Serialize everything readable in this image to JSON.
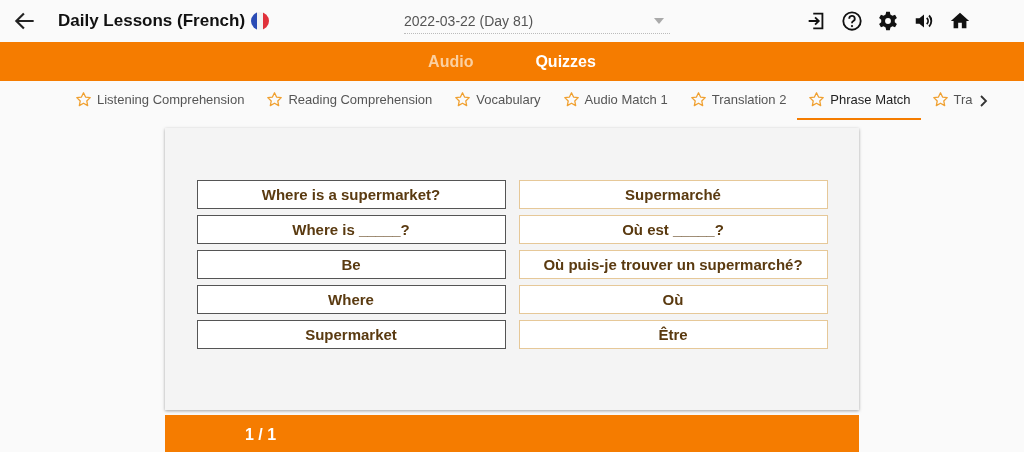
{
  "header": {
    "title": "Daily Lessons (French)",
    "date_select": "2022-03-22 (Day 81)"
  },
  "main_tabs": [
    {
      "label": "Audio",
      "selected": false
    },
    {
      "label": "Quizzes",
      "selected": true
    }
  ],
  "quiz_tabs": [
    {
      "label": "Listening Comprehension",
      "selected": false
    },
    {
      "label": "Reading Comprehension",
      "selected": false
    },
    {
      "label": "Vocabulary",
      "selected": false
    },
    {
      "label": "Audio Match 1",
      "selected": false
    },
    {
      "label": "Translation 2",
      "selected": false
    },
    {
      "label": "Phrase Match",
      "selected": true
    },
    {
      "label": "Tra",
      "selected": false
    }
  ],
  "match": {
    "left": [
      "Where is a supermarket?",
      "Where is _____?",
      "Be",
      "Where",
      "Supermarket"
    ],
    "right": [
      "Supermarché",
      "Où est _____?",
      "Où puis-je trouver un supermarché?",
      "Où",
      "Être"
    ]
  },
  "footer": {
    "page": "1 / 1"
  }
}
